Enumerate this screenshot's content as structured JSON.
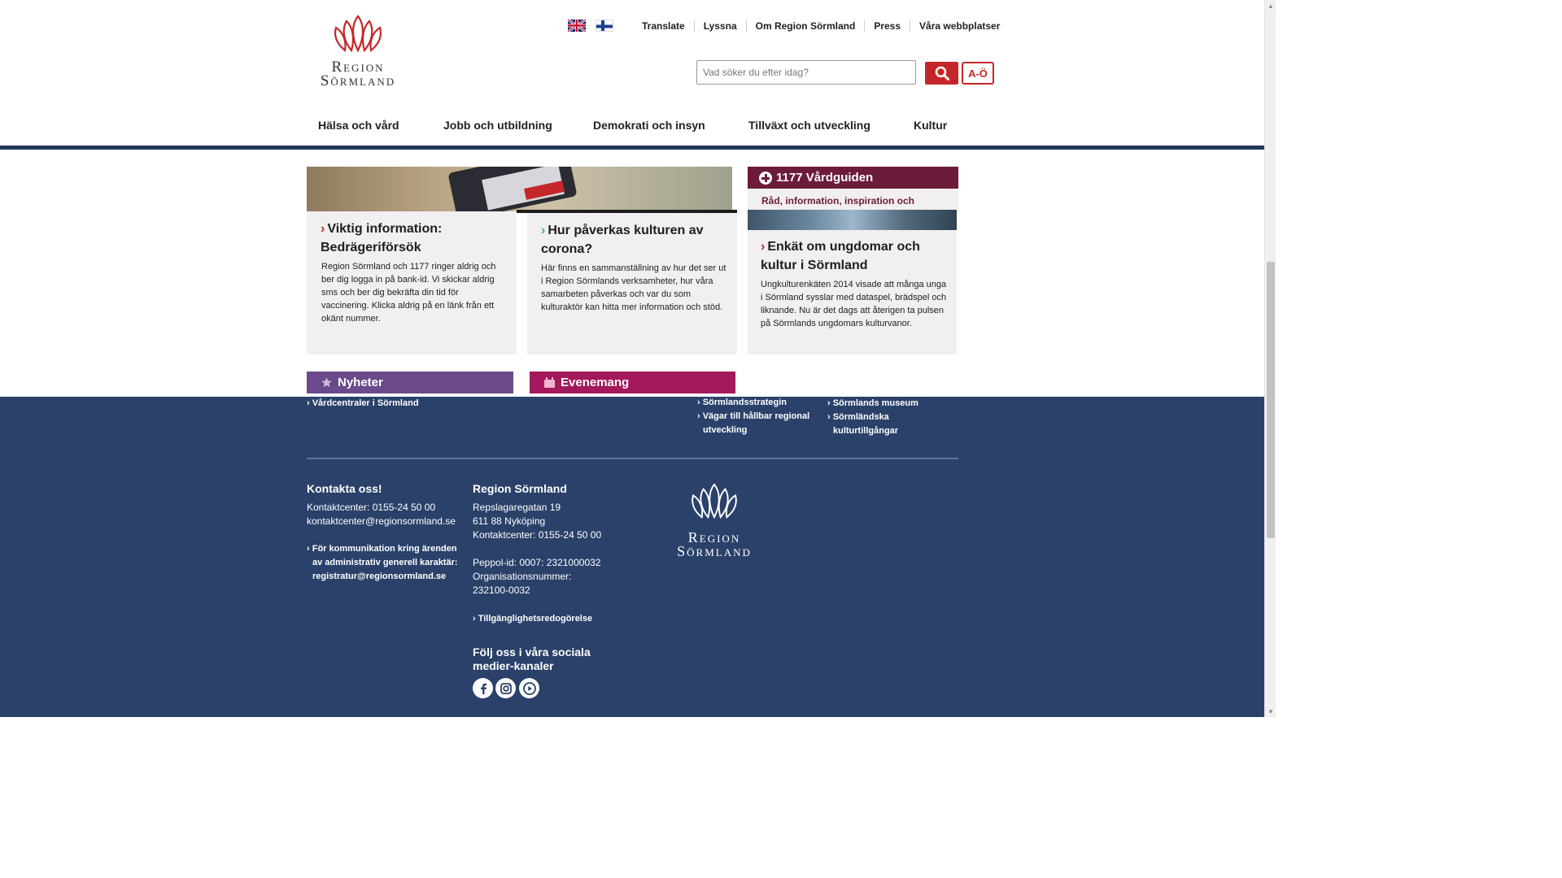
{
  "header": {
    "logo_line1": "Region",
    "logo_line2": "Sörmland",
    "utility_links": [
      "Translate",
      "Lyssna",
      "Om Region Sörmland",
      "Press",
      "Våra webbplatser"
    ],
    "search_placeholder": "Vad söker du efter idag?",
    "az_label": "A-Ö"
  },
  "nav": {
    "items": [
      "Hälsa och vård",
      "Jobb och utbildning",
      "Demokrati och insyn",
      "Tillväxt och utveckling",
      "Kultur"
    ]
  },
  "cards": [
    {
      "chevron": "›",
      "title": "Viktig information: Bedrägeriförsök",
      "text": "Region Sörmland och 1177 ringer aldrig och ber dig logga in på bank-id. Vi skickar aldrig sms och ber dig bekräfta din tid för vaccinering. Klicka aldrig på en länk från ett okänt nummer."
    },
    {
      "chevron": "›",
      "title": "Hur påverkas kulturen av corona?",
      "text": "Här finns en sammanställning av hur det ser ut i Region Sörmlands verksamheter, hur våra samarbeten påverkas och var du som kulturaktör kan hitta mer information och stöd."
    },
    {
      "chevron": "›",
      "title": "Enkät om ungdomar och kultur i Sörmland",
      "text": "Ungkulturenkäten 2014 visade att många unga i Sörmland sysslar med dataspel, brädspel och liknande. Nu är det dags att återigen ta pulsen på Sörmlands ungdomars kulturvanor."
    }
  ],
  "vardguiden": {
    "title": "1177 Vårdguiden",
    "subtitle": "Råd, information, inspiration och"
  },
  "nyheter": {
    "title": "Nyheter"
  },
  "evenemang": {
    "title": "Evenemang"
  },
  "footer": {
    "quicklinks": {
      "col1": [
        "› Vårdcentraler i Sörmland"
      ],
      "col2": [
        "› Sörmlandsstrategin",
        "› Vägar till hållbar regional",
        "utveckling"
      ],
      "col3": [
        "› Sörmlands museum",
        "› Sörmländska",
        "kulturtillgångar"
      ]
    },
    "contact": {
      "title": "Kontakta oss!",
      "phone": "Kontaktcenter: 0155-24 50 00",
      "email": "kontaktcenter@regionsormland.se",
      "registratur": [
        "› För kommunikation kring ärenden",
        "av administrativ generell karaktär:",
        "registratur@regionsormland.se"
      ]
    },
    "region": {
      "title": "Region Sörmland",
      "address1": "Repslagaregatan 19",
      "address2": "611 88 Nyköping",
      "phone": "Kontaktcenter: 0155-24 50 00",
      "peppol": "Peppol-id: 0007: 2321000032",
      "org_label": "Organisationsnummer:",
      "org_number": "232100-0032",
      "accessibility": "› Tillgänglighetsredogörelse"
    },
    "social": {
      "title_line1": "Följ oss i våra sociala",
      "title_line2": "medier-kanaler",
      "icons": [
        "facebook-icon",
        "instagram-icon",
        "youtube-icon"
      ]
    },
    "logo_line1": "Region",
    "logo_line2": "Sörmland"
  },
  "colors": {
    "brand_red": "#c4272a",
    "navy": "#2a416a",
    "vardguiden": "#6d1b3b",
    "nyheter": "#6b4a8b",
    "evenemang": "#a3195b"
  }
}
